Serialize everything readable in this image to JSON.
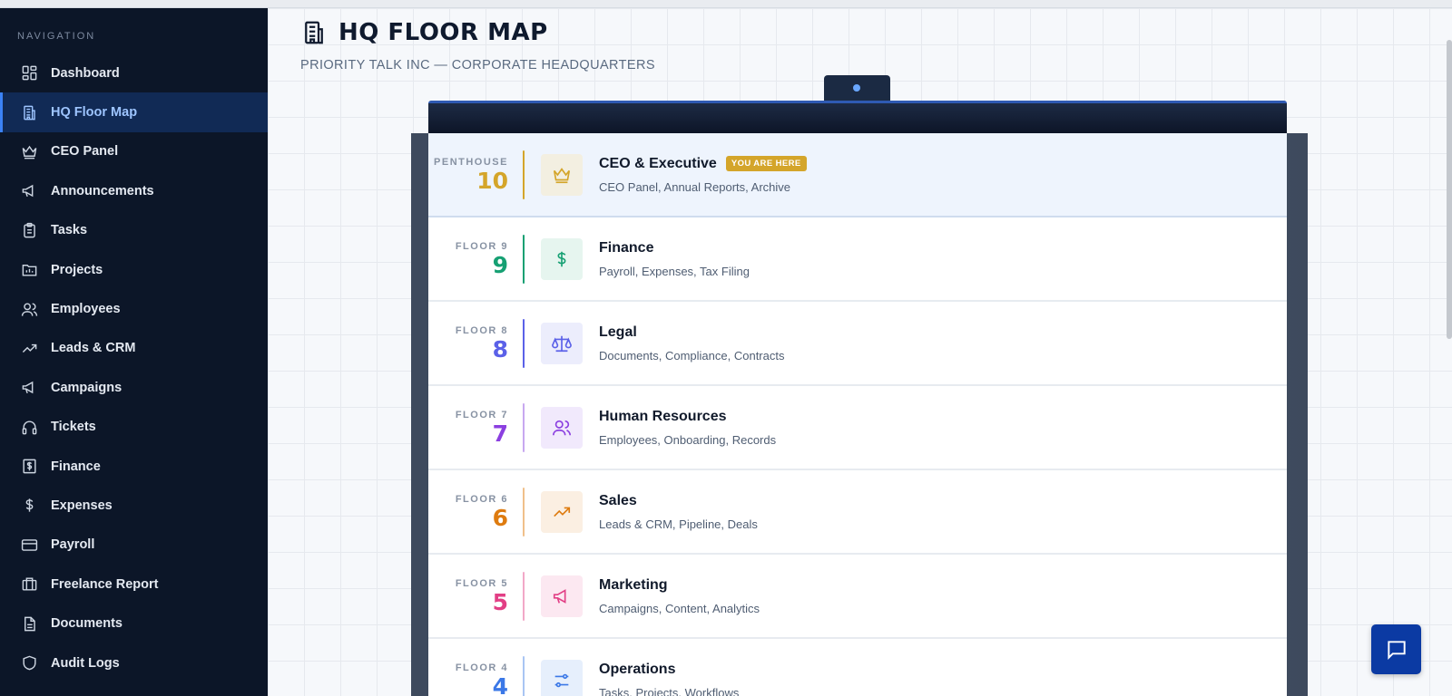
{
  "sidebar": {
    "heading": "NAVIGATION",
    "items": [
      {
        "label": "Dashboard",
        "icon": "dashboard-icon"
      },
      {
        "label": "HQ Floor Map",
        "icon": "building-icon",
        "active": true
      },
      {
        "label": "CEO Panel",
        "icon": "crown-icon"
      },
      {
        "label": "Announcements",
        "icon": "megaphone-icon"
      },
      {
        "label": "Tasks",
        "icon": "clipboard-icon"
      },
      {
        "label": "Projects",
        "icon": "folder-chart-icon"
      },
      {
        "label": "Employees",
        "icon": "users-icon"
      },
      {
        "label": "Leads & CRM",
        "icon": "trending-up-icon"
      },
      {
        "label": "Campaigns",
        "icon": "megaphone-icon"
      },
      {
        "label": "Tickets",
        "icon": "headphones-icon"
      },
      {
        "label": "Finance",
        "icon": "dollar-receipt-icon"
      },
      {
        "label": "Expenses",
        "icon": "dollar-icon"
      },
      {
        "label": "Payroll",
        "icon": "credit-card-icon"
      },
      {
        "label": "Freelance Report",
        "icon": "briefcase-icon"
      },
      {
        "label": "Documents",
        "icon": "document-icon"
      },
      {
        "label": "Audit Logs",
        "icon": "shield-icon"
      }
    ]
  },
  "header": {
    "title": "HQ FLOOR MAP",
    "subtitle": "PRIORITY TALK INC — CORPORATE HEADQUARTERS"
  },
  "floors": [
    {
      "label": "PENTHOUSE",
      "number": "10",
      "name": "CEO & Executive",
      "desc": "CEO Panel, Annual Reports, Archive",
      "badge": "YOU ARE HERE",
      "color": "#d4a52a",
      "icon": "crown-icon"
    },
    {
      "label": "FLOOR 9",
      "number": "9",
      "name": "Finance",
      "desc": "Payroll, Expenses, Tax Filing",
      "color": "#16a073",
      "icon": "dollar-icon"
    },
    {
      "label": "FLOOR 8",
      "number": "8",
      "name": "Legal",
      "desc": "Documents, Compliance, Contracts",
      "color": "#5b61e8",
      "icon": "scales-icon"
    },
    {
      "label": "FLOOR 7",
      "number": "7",
      "name": "Human Resources",
      "desc": "Employees, Onboarding, Records",
      "color": "#8b3fe0",
      "icon": "users-icon"
    },
    {
      "label": "FLOOR 6",
      "number": "6",
      "name": "Sales",
      "desc": "Leads & CRM, Pipeline, Deals",
      "color": "#de7b0f",
      "icon": "trending-up-icon"
    },
    {
      "label": "FLOOR 5",
      "number": "5",
      "name": "Marketing",
      "desc": "Campaigns, Content, Analytics",
      "color": "#e23f85",
      "icon": "megaphone-icon"
    },
    {
      "label": "FLOOR 4",
      "number": "4",
      "name": "Operations",
      "desc": "Tasks, Projects, Workflows",
      "color": "#3b78e7",
      "icon": "sliders-icon"
    }
  ],
  "chat": {
    "icon": "chat-icon"
  }
}
